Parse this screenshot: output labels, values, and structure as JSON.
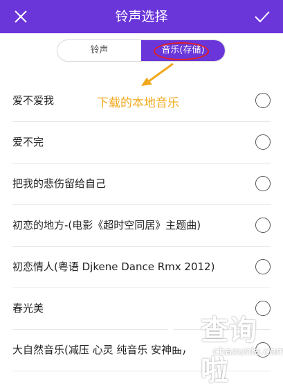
{
  "header": {
    "title": "铃声选择",
    "close_icon": "close-icon",
    "confirm_icon": "check-icon"
  },
  "segment": {
    "tab_ringtone": "铃声",
    "tab_music": "音乐(存储)"
  },
  "annotation": {
    "text": "下载的本地音乐"
  },
  "songs": [
    {
      "name": "爱不爱我"
    },
    {
      "name": "爱不完"
    },
    {
      "name": "把我的悲伤留给自己"
    },
    {
      "name": "初恋的地方-(电影《超时空同居》主题曲)"
    },
    {
      "name": "初恋情人(粤语 Djkene Dance Rmx 2012)"
    },
    {
      "name": "春光美"
    },
    {
      "name": "大自然音乐(减压 心灵 纯音乐 安神曲)"
    }
  ],
  "watermark": {
    "main": "查询啦",
    "sub": "chaxunla.com"
  },
  "colors": {
    "accent": "#6a35d9",
    "annotation": "#f0a81c",
    "highlight_oval": "#e0202a"
  }
}
